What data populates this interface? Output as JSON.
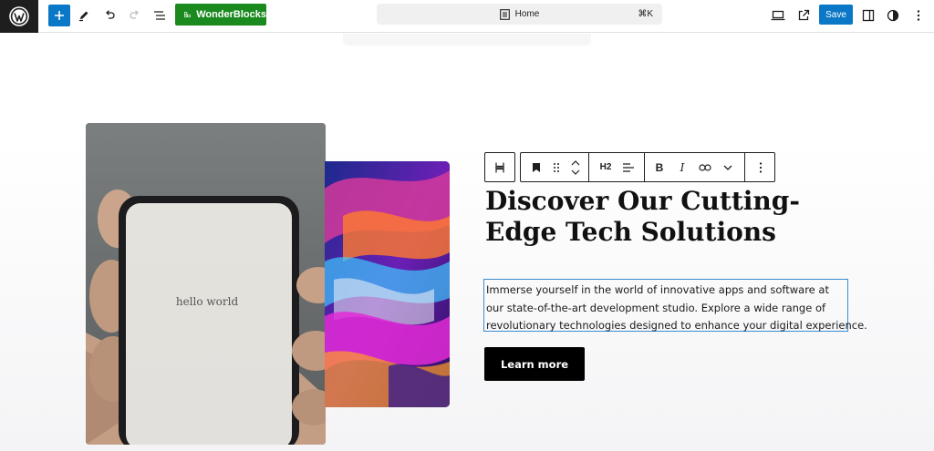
{
  "topbar": {
    "wonderblocks_label": "WonderBlocks",
    "document_title": "Home",
    "shortcut": "⌘K",
    "save_label": "Save"
  },
  "toolbar": {
    "heading_level": "H2",
    "bold": "B",
    "italic": "I"
  },
  "content": {
    "heading": "Discover Our Cutting-Edge Tech Solutions",
    "heading_line1": "Discover Our Cutting-",
    "heading_line2": "Edge Tech Solutions",
    "paragraph_line1": "Immerse yourself in the world of innovative apps and software at",
    "paragraph_line2": "our state-of-the-art development studio. Explore a wide range of",
    "paragraph_line3": "revolutionary technologies designed to enhance your digital experience.",
    "button_label": "Learn more",
    "phone_screen_text": "hello world"
  },
  "colors": {
    "accent": "#0a78c7",
    "wonderblocks": "#1a8a1f",
    "button": "#000000"
  }
}
